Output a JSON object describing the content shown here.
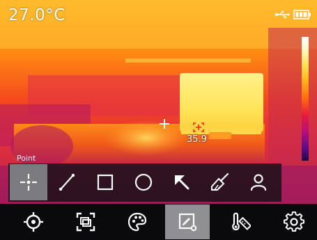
{
  "status": {
    "center_temperature": "27.0°C",
    "hotspot_temperature": "35.9",
    "usb_icon": "usb-icon",
    "battery_icon": "battery-icon"
  },
  "measure_toolbar": {
    "mode_label": "Point",
    "active_tool": "point",
    "tools": [
      {
        "id": "point",
        "icon": "crosshair-point-icon"
      },
      {
        "id": "line",
        "icon": "line-icon"
      },
      {
        "id": "rectangle",
        "icon": "rectangle-icon"
      },
      {
        "id": "circle",
        "icon": "circle-icon"
      },
      {
        "id": "arrow",
        "icon": "arrow-icon"
      },
      {
        "id": "clear",
        "icon": "broom-icon"
      },
      {
        "id": "user",
        "icon": "person-icon"
      }
    ]
  },
  "bottom_nav": {
    "active_item": "measure",
    "items": [
      {
        "id": "target",
        "icon": "target-icon"
      },
      {
        "id": "image-mode",
        "icon": "image-frame-icon"
      },
      {
        "id": "palette",
        "icon": "palette-icon"
      },
      {
        "id": "measure",
        "icon": "measure-edit-icon"
      },
      {
        "id": "temperature-range",
        "icon": "thermometer-ruler-icon"
      },
      {
        "id": "settings",
        "icon": "gear-icon"
      }
    ]
  },
  "colors": {
    "palette_hot": "#ffffff",
    "palette_mid": "#ff6a10",
    "palette_cold": "#1c0848"
  }
}
